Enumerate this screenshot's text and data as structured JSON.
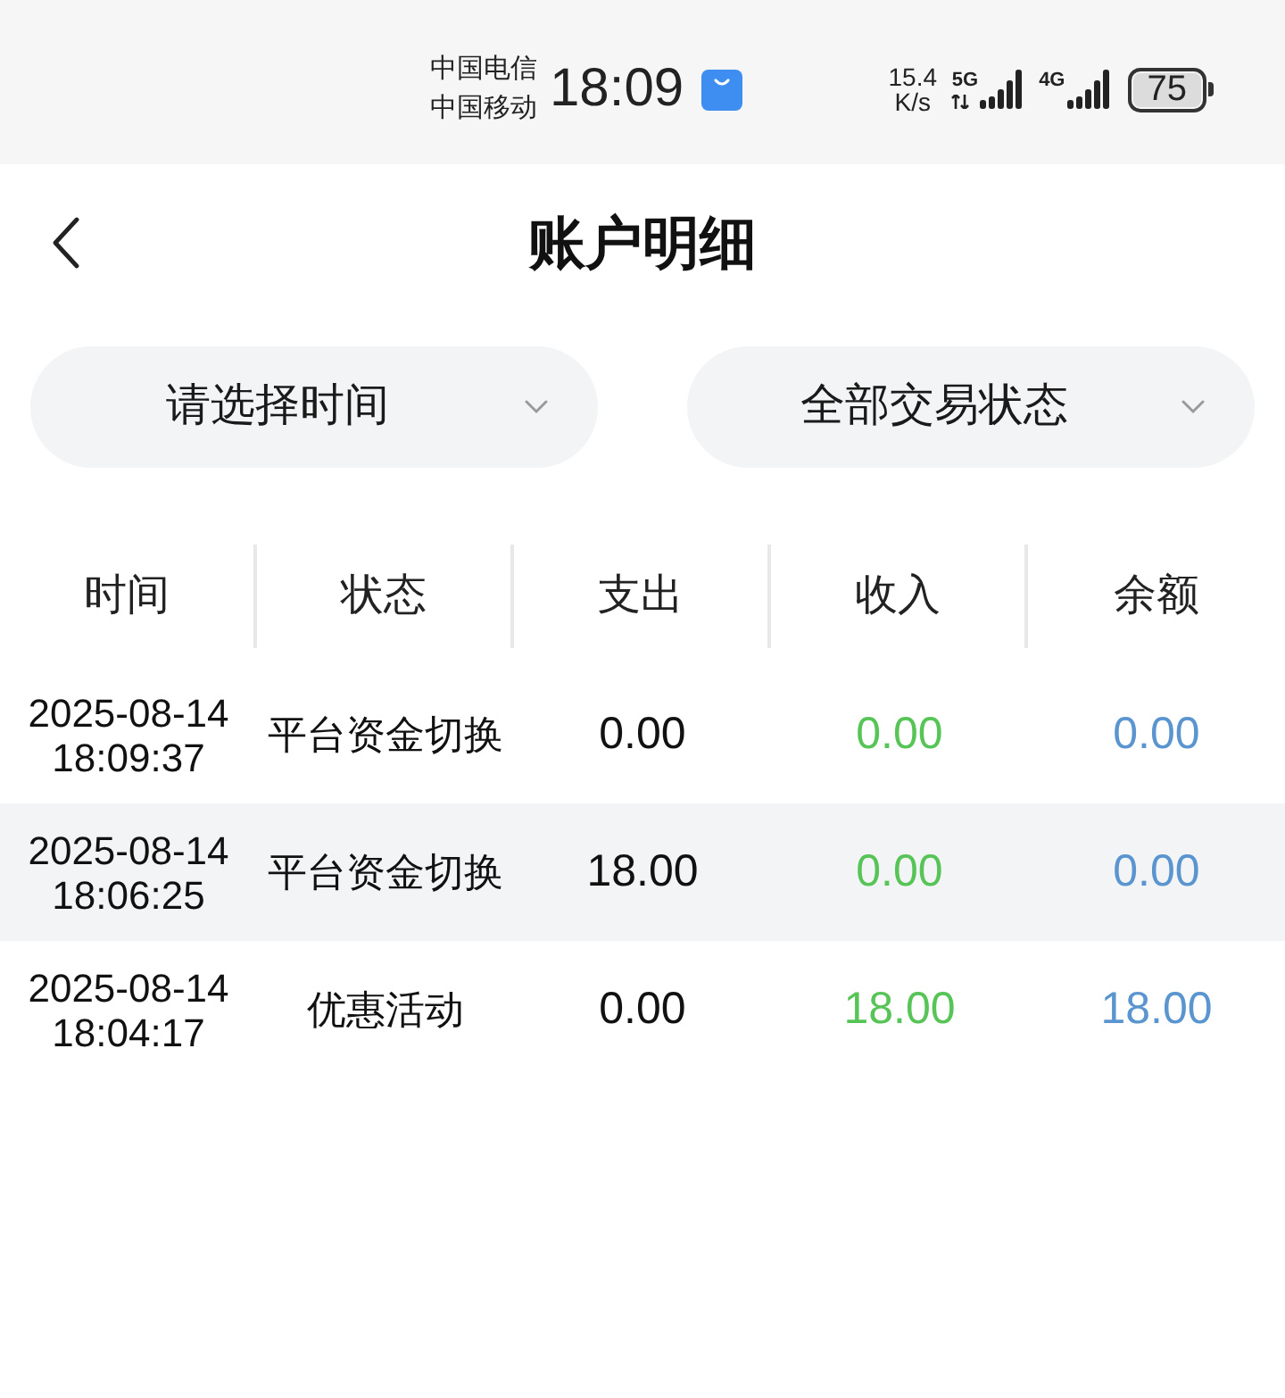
{
  "status_bar": {
    "carriers": [
      "中国电信",
      "中国移动"
    ],
    "time": "18:09",
    "network_speed": "15.4 K/s",
    "signals": [
      {
        "label": "5G",
        "data_active": true
      },
      {
        "label": "4G",
        "data_active": false
      }
    ],
    "battery": "75"
  },
  "header": {
    "title": "账户明细"
  },
  "filters": [
    {
      "label": "请选择时间"
    },
    {
      "label": "全部交易状态"
    }
  ],
  "table": {
    "columns": [
      "时间",
      "状态",
      "支出",
      "收入",
      "余额"
    ],
    "rows": [
      {
        "time": "2025-08-14 18:09:37",
        "status": "平台资金切换",
        "expense": "0.00",
        "income": "0.00",
        "balance": "0.00"
      },
      {
        "time": "2025-08-14 18:06:25",
        "status": "平台资金切换",
        "expense": "18.00",
        "income": "0.00",
        "balance": "0.00"
      },
      {
        "time": "2025-08-14 18:04:17",
        "status": "优惠活动",
        "expense": "0.00",
        "income": "18.00",
        "balance": "18.00"
      }
    ]
  }
}
